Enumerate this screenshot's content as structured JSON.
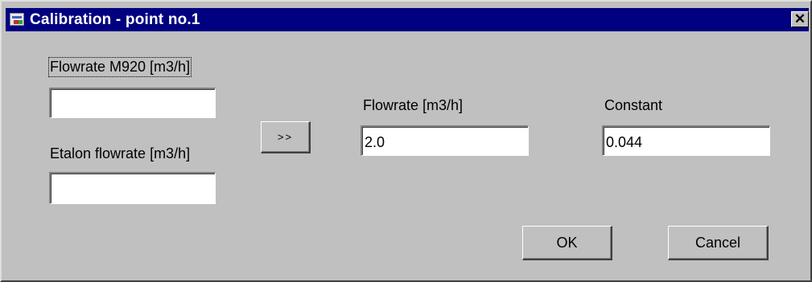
{
  "window": {
    "title": "Calibration - point no.1",
    "close_glyph": "✕"
  },
  "left_panel": {
    "flowrate_m920_label": "Flowrate M920 [m3/h]",
    "flowrate_m920_value": "",
    "etalon_flowrate_label": "Etalon flowrate [m3/h]",
    "etalon_flowrate_value": ""
  },
  "transfer_button_label": ">>",
  "right_panel": {
    "flowrate_label": "Flowrate [m3/h]",
    "flowrate_value": "2.0",
    "constant_label": "Constant",
    "constant_value": "0.044"
  },
  "buttons": {
    "ok_label": "OK",
    "cancel_label": "Cancel"
  },
  "colors": {
    "titlebar": "#000080",
    "face": "#c0c0c0"
  }
}
